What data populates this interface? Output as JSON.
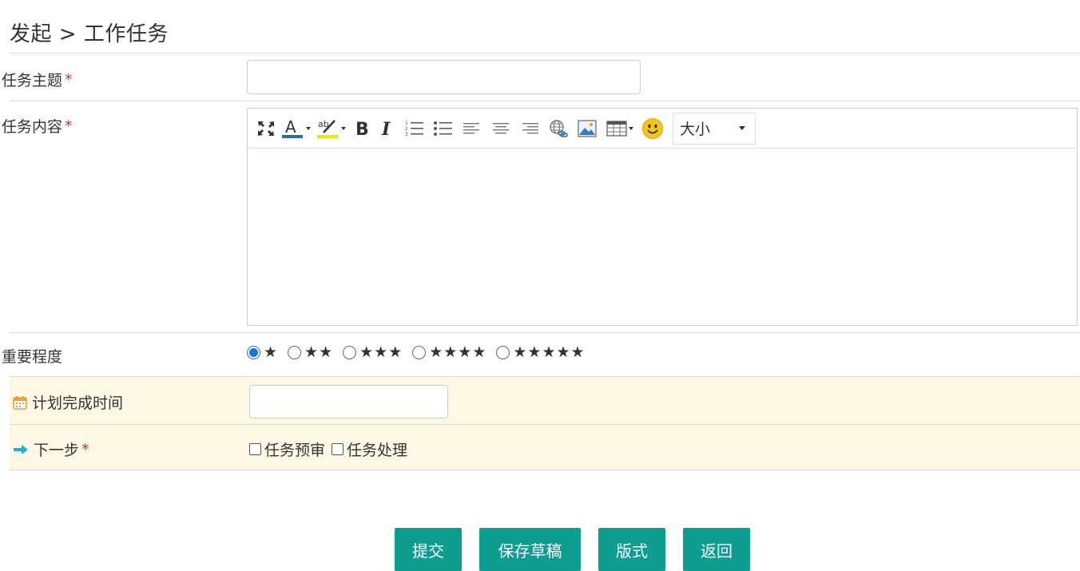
{
  "breadcrumb": {
    "text": "发起 > 工作任务"
  },
  "form": {
    "subject": {
      "label": "任务主题",
      "required": "*",
      "value": ""
    },
    "content": {
      "label": "任务内容",
      "required": "*"
    },
    "importance": {
      "label": "重要程度",
      "options": [
        "★",
        "★★",
        "★★★",
        "★★★★",
        "★★★★★"
      ],
      "selected_index": 0
    },
    "plan_time": {
      "label": "计划完成时间",
      "value": "",
      "icon": "calendar-icon"
    },
    "next_step": {
      "label": "下一步",
      "required": "*",
      "icon": "arrow-right-icon",
      "options": [
        "任务预审",
        "任务处理"
      ]
    }
  },
  "editor": {
    "toolbar": [
      "fullscreen-icon",
      "font-color-icon",
      "highlight-icon",
      "bold-icon",
      "italic-icon",
      "ordered-list-icon",
      "unordered-list-icon",
      "align-left-icon",
      "align-center-icon",
      "align-right-icon",
      "link-icon",
      "image-icon",
      "table-icon",
      "emoji-icon"
    ],
    "size_label": "大小",
    "body": ""
  },
  "buttons": {
    "submit": "提交",
    "save_draft": "保存草稿",
    "format": "版式",
    "back": "返回"
  },
  "colors": {
    "accent": "#0f9c91",
    "row_highlight": "#fcf8e3",
    "radio": "#1a73e8",
    "required": "#c0392b"
  }
}
